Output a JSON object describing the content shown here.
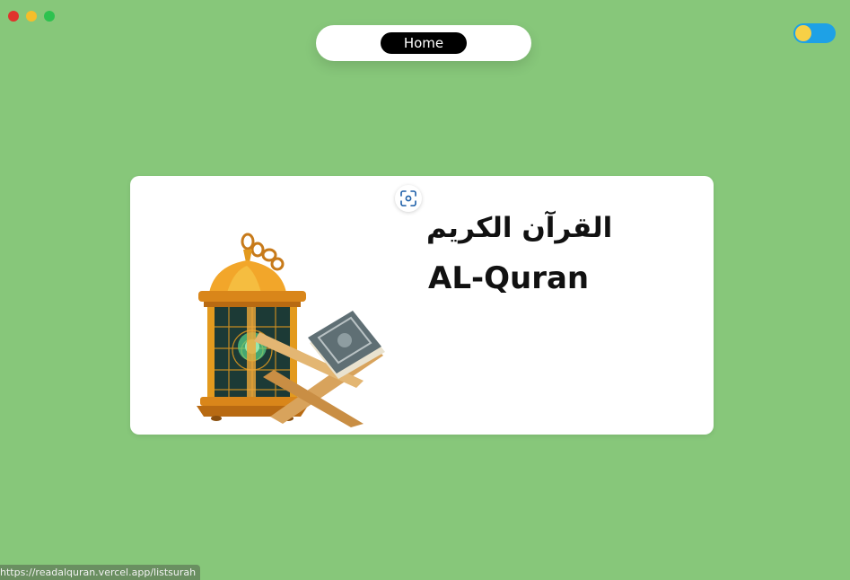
{
  "window": {
    "controls": [
      "close",
      "minimize",
      "maximize"
    ]
  },
  "nav": {
    "home_label": "Home"
  },
  "theme_toggle": {
    "icon": "sun-icon",
    "state": "on",
    "accent": "#1ea1e6"
  },
  "card": {
    "title_arabic": "القرآن الكريم",
    "title_latin": "AL-Quran",
    "illustration": "lantern-and-quran-stand",
    "lens_icon": "lens-search-icon"
  },
  "status_bar": {
    "url": "https://readalquran.vercel.app/listsurah"
  },
  "colors": {
    "background": "#87c77a",
    "card": "#ffffff",
    "nav_active": "#000000"
  }
}
